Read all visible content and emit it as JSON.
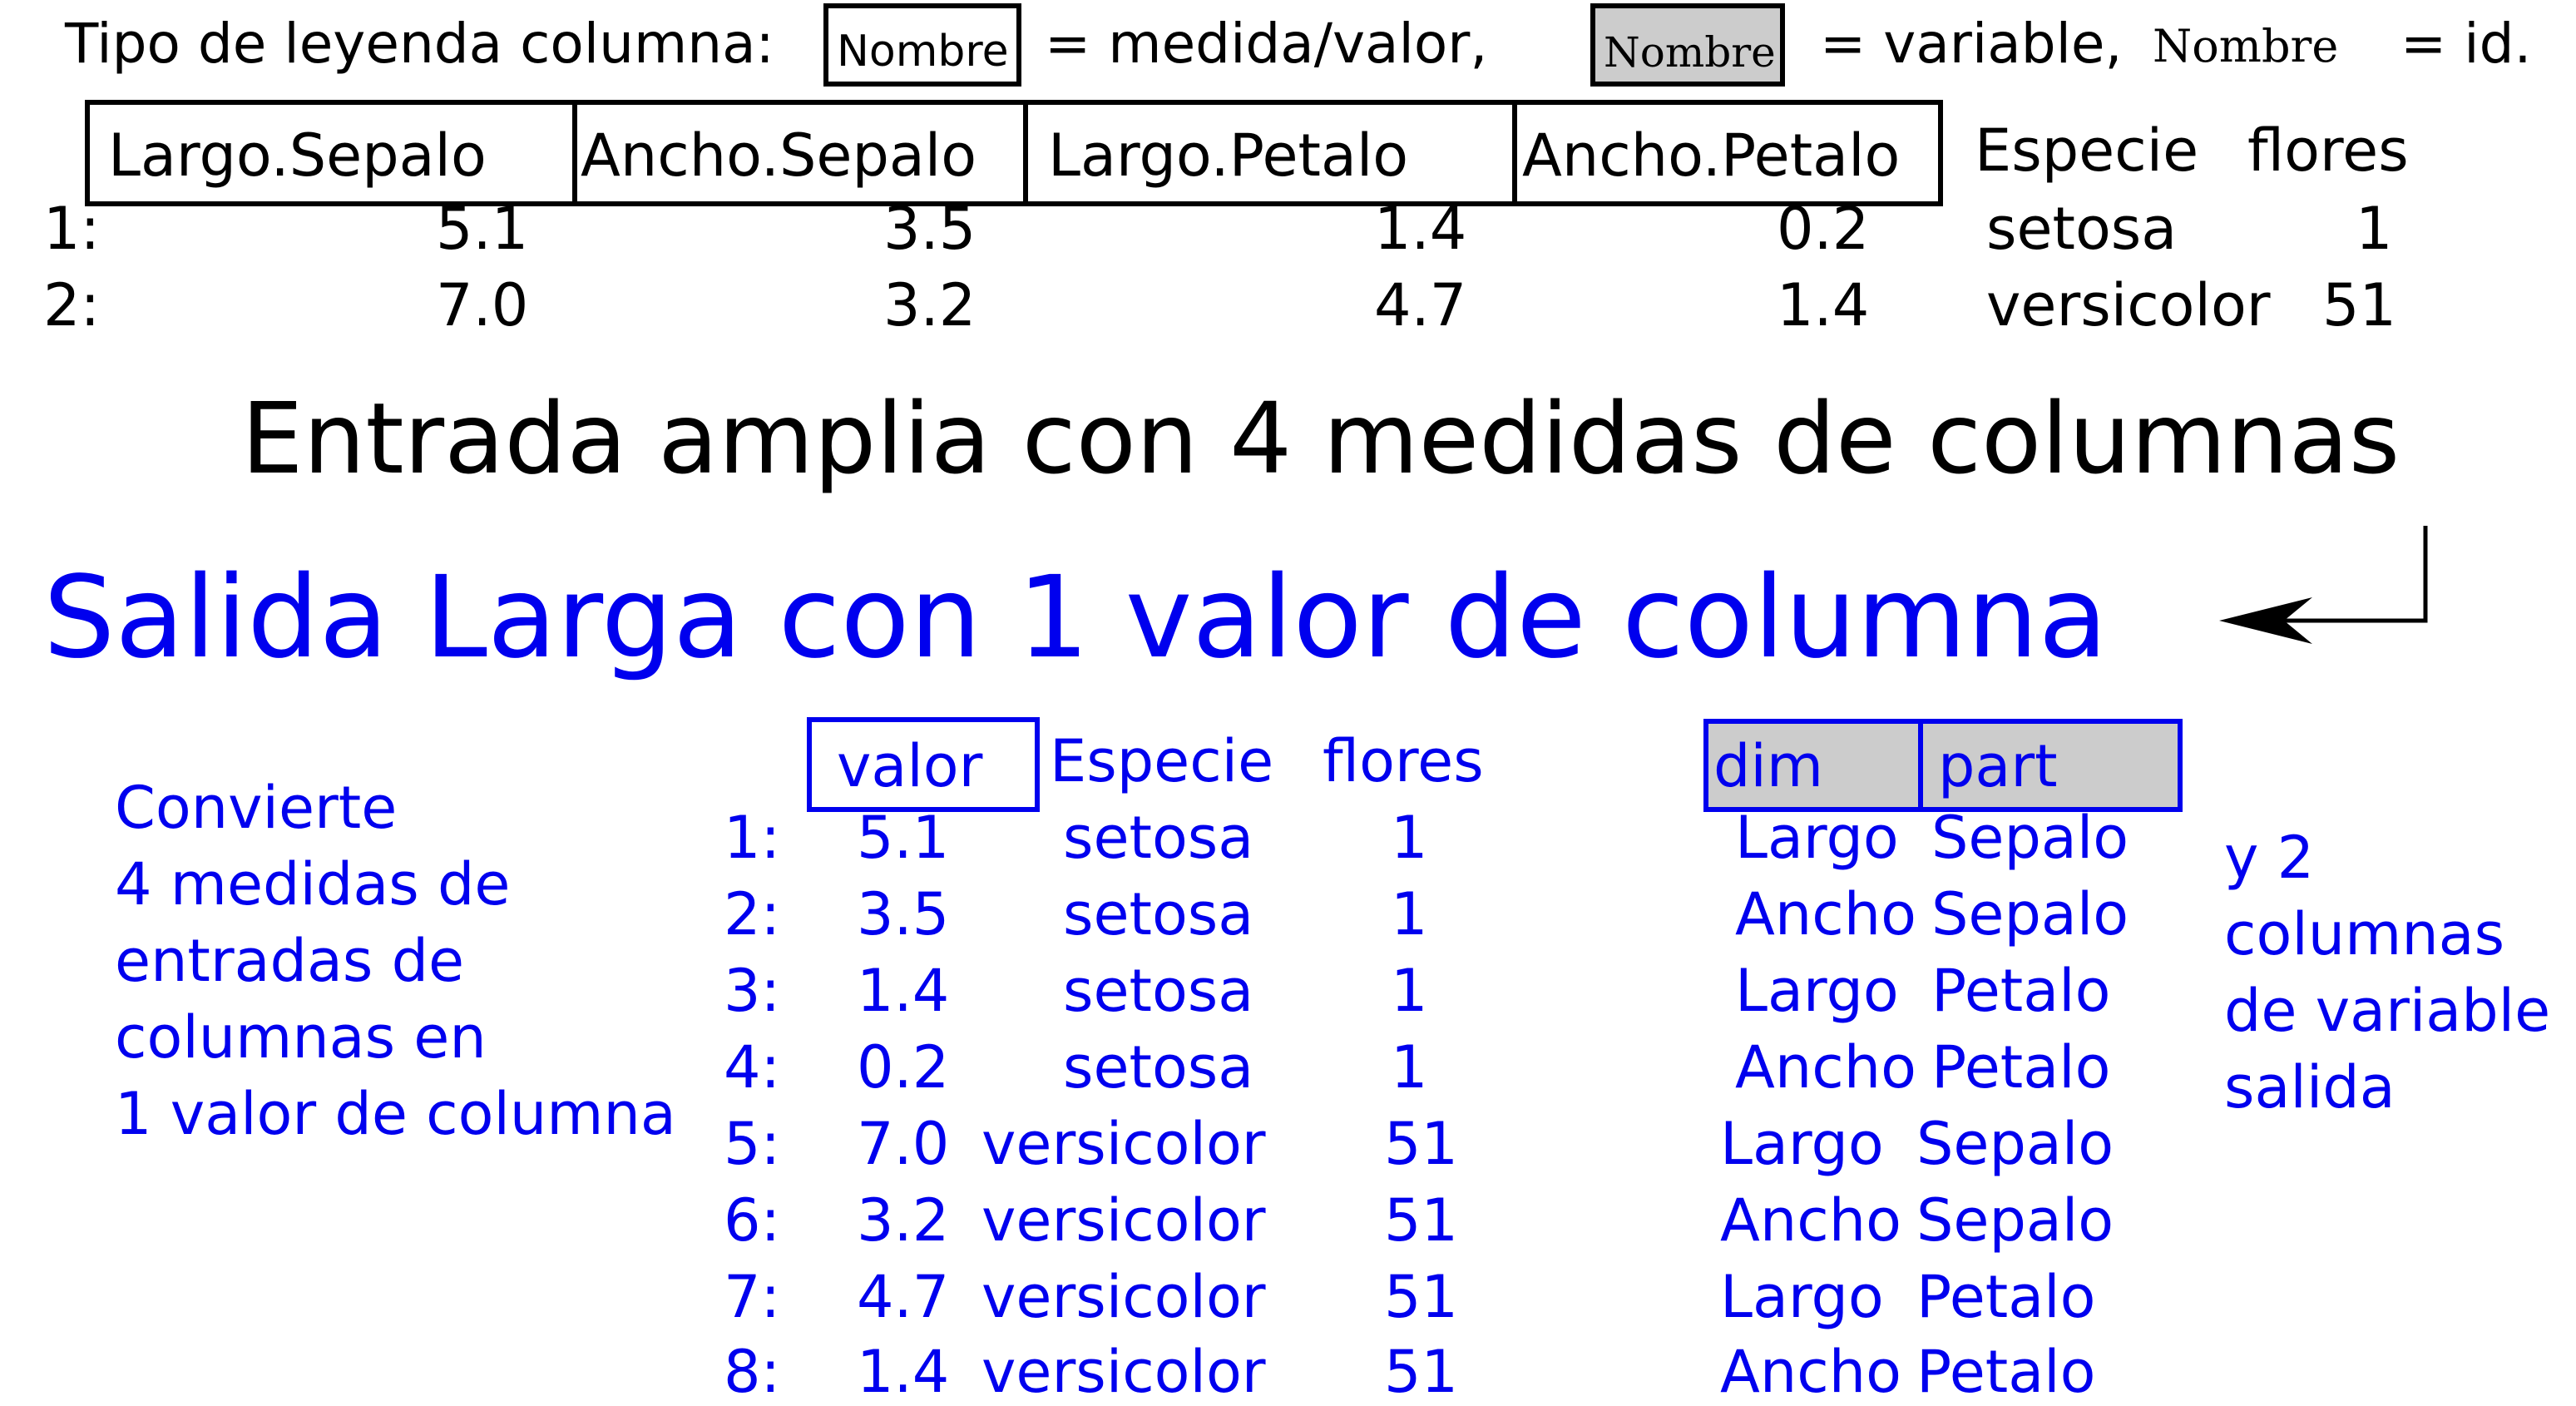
{
  "legend": {
    "prefix": "Tipo de leyenda columna:",
    "name_label": "Nombre",
    "measure_text": "= medida/valor,",
    "variable_text": "= variable,",
    "id_text": "= id."
  },
  "wide_table": {
    "headers": [
      "Largo.Sepalo",
      "Ancho.Sepalo",
      "Largo.Petalo",
      "Ancho.Petalo",
      "Especie",
      "flores"
    ],
    "rows": [
      {
        "idx": "1:",
        "ls": "5.1",
        "as": "3.5",
        "lp": "1.4",
        "ap": "0.2",
        "especie": "setosa",
        "flores": "1"
      },
      {
        "idx": "2:",
        "ls": "7.0",
        "as": "3.2",
        "lp": "4.7",
        "ap": "1.4",
        "especie": "versicolor",
        "flores": "51"
      }
    ]
  },
  "titles": {
    "wide": "Entrada amplia con 4 medidas de columnas",
    "long": "Salida Larga con 1 valor de columna"
  },
  "left_note": [
    "Convierte",
    "4 medidas de",
    "entradas de",
    "columnas en",
    "1 valor de columna"
  ],
  "right_note": [
    "y 2",
    "columnas",
    "de variable",
    "salida"
  ],
  "long_table": {
    "headers": [
      "valor",
      "Especie",
      "flores",
      "dim",
      "part"
    ],
    "rows": [
      {
        "idx": "1:",
        "valor": "5.1",
        "especie": "setosa",
        "flores": "1",
        "dim": "Largo",
        "part": "Sepalo"
      },
      {
        "idx": "2:",
        "valor": "3.5",
        "especie": "setosa",
        "flores": "1",
        "dim": "Ancho",
        "part": "Sepalo"
      },
      {
        "idx": "3:",
        "valor": "1.4",
        "especie": "setosa",
        "flores": "1",
        "dim": "Largo",
        "part": "Petalo"
      },
      {
        "idx": "4:",
        "valor": "0.2",
        "especie": "setosa",
        "flores": "1",
        "dim": "Ancho",
        "part": "Petalo"
      },
      {
        "idx": "5:",
        "valor": "7.0",
        "especie": "versicolor",
        "flores": "51",
        "dim": "Largo",
        "part": "Sepalo"
      },
      {
        "idx": "6:",
        "valor": "3.2",
        "especie": "versicolor",
        "flores": "51",
        "dim": "Ancho",
        "part": "Sepalo"
      },
      {
        "idx": "7:",
        "valor": "4.7",
        "especie": "versicolor",
        "flores": "51",
        "dim": "Largo",
        "part": "Petalo"
      },
      {
        "idx": "8:",
        "valor": "1.4",
        "especie": "versicolor",
        "flores": "51",
        "dim": "Ancho",
        "part": "Petalo"
      }
    ]
  },
  "colors": {
    "blue": "#0000ee",
    "black": "#000000",
    "grey": "#cccccc"
  }
}
